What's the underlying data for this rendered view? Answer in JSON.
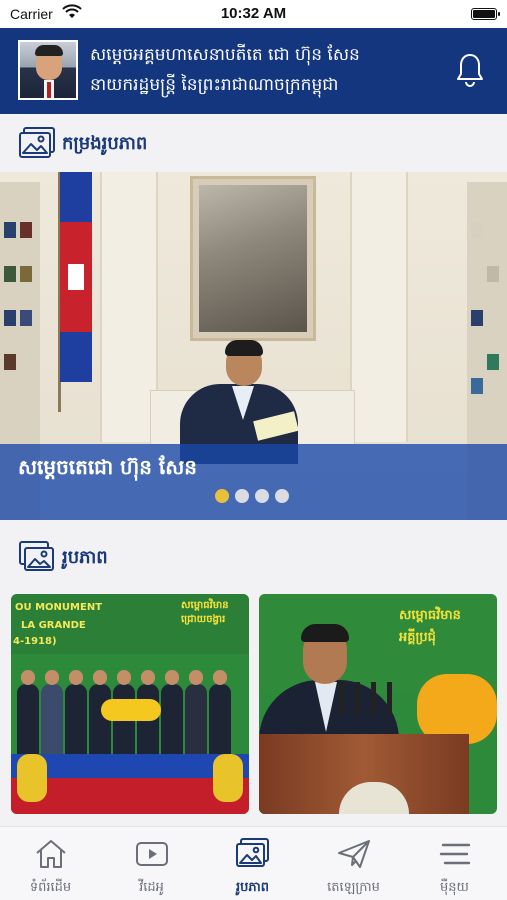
{
  "status_bar": {
    "carrier": "Carrier",
    "time": "10:32 AM"
  },
  "header": {
    "title_line1": "សម្តេចអគ្គមហាសេនាបតីតេ ជោ ហ៊ុន សែន",
    "title_line2": "នាយករដ្ឋមន្ត្រី នៃព្រះរាជាណាចក្រកម្ពុជា",
    "notification_icon": "bell-icon"
  },
  "gallery_section": {
    "title": "កម្រងរូបភាព",
    "icon": "image-gallery-icon"
  },
  "featured_slide": {
    "caption": "សម្តេចតេជោ ហ៊ុន សែន",
    "total_slides": 4,
    "active_index": 0
  },
  "photos_section": {
    "title": "រូបភាព",
    "icon": "photo-stack-icon"
  },
  "photo_cards": [
    {
      "banner_left": "OU MONUMENT",
      "banner_left2": "LA GRANDE",
      "banner_left3": "4-1918)",
      "banner_right": "សម្ពោធវិមាន",
      "banner_right2": "ជ្រោយចង្វារ"
    },
    {
      "banner_right": "សម្ពោធវិមាន",
      "banner_right2": "អគ្គីប្រជុំ"
    }
  ],
  "tabs": [
    {
      "label": "ទំព័រដើម",
      "icon": "home-icon",
      "active": false
    },
    {
      "label": "វីដេអូ",
      "icon": "video-play-icon",
      "active": false
    },
    {
      "label": "រូបភាព",
      "icon": "image-icon",
      "active": true
    },
    {
      "label": "តេឡេក្រាម",
      "icon": "telegram-send-icon",
      "active": false
    },
    {
      "label": "ម៉ឺនុយ",
      "icon": "menu-icon",
      "active": false
    }
  ],
  "colors": {
    "header_bg": "#14367f",
    "accent_text": "#1b3a7a",
    "caption_band": "#1848aa",
    "active_dot": "#e8c03c",
    "inactive_tab": "#6b6f78"
  }
}
